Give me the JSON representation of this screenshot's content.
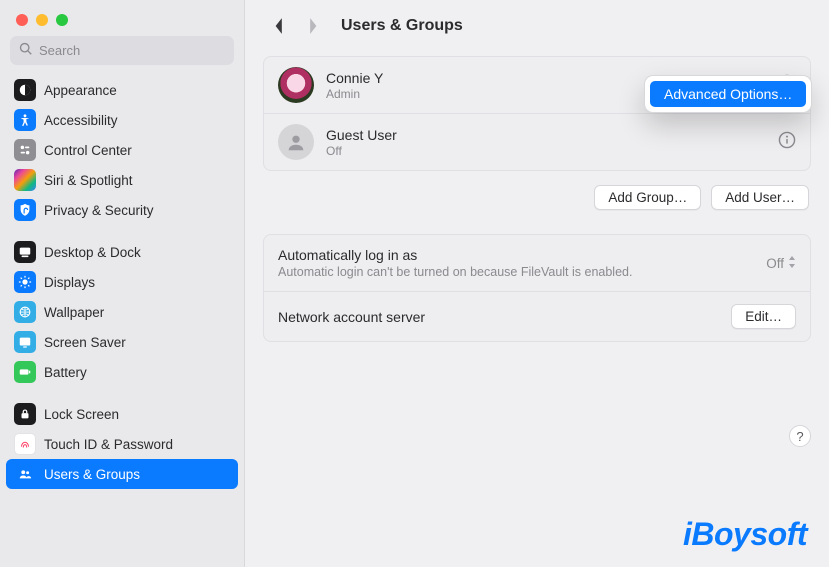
{
  "window": {
    "search_placeholder": "Search",
    "title": "Users & Groups"
  },
  "sidebar": {
    "groups": [
      [
        {
          "label": "Appearance"
        },
        {
          "label": "Accessibility"
        },
        {
          "label": "Control Center"
        },
        {
          "label": "Siri & Spotlight"
        },
        {
          "label": "Privacy & Security"
        }
      ],
      [
        {
          "label": "Desktop & Dock"
        },
        {
          "label": "Displays"
        },
        {
          "label": "Wallpaper"
        },
        {
          "label": "Screen Saver"
        },
        {
          "label": "Battery"
        }
      ],
      [
        {
          "label": "Lock Screen"
        },
        {
          "label": "Touch ID & Password"
        },
        {
          "label": "Users & Groups"
        }
      ]
    ]
  },
  "users": [
    {
      "name": "Connie Y",
      "sub": "Admin"
    },
    {
      "name": "Guest User",
      "sub": "Off"
    }
  ],
  "context_menu": {
    "item": "Advanced Options…"
  },
  "buttons": {
    "add_group": "Add Group…",
    "add_user": "Add User…"
  },
  "settings": {
    "auto_login": {
      "title": "Automatically log in as",
      "sub": "Automatic login can't be turned on because FileVault is enabled.",
      "value": "Off"
    },
    "network": {
      "title": "Network account server",
      "button": "Edit…"
    }
  },
  "help": "?",
  "watermark": "iBoysoft"
}
